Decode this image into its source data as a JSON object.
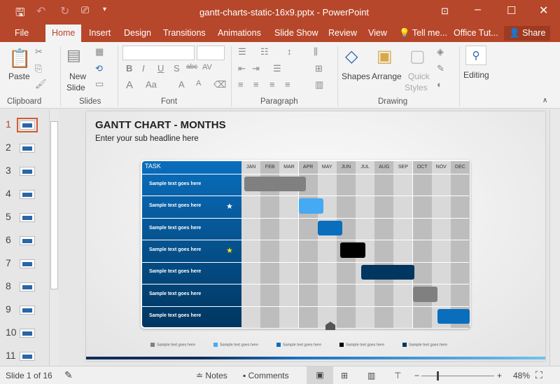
{
  "window": {
    "title": "gantt-charts-static-16x9.pptx - PowerPoint"
  },
  "tabs": [
    "File",
    "Home",
    "Insert",
    "Design",
    "Transitions",
    "Animations",
    "Slide Show",
    "Review",
    "View",
    "Tell me...",
    "Office Tut...",
    "Share"
  ],
  "active_tab": "Home",
  "ribbon": {
    "groups": [
      "Clipboard",
      "Slides",
      "Font",
      "Paragraph",
      "Drawing"
    ],
    "paste": "Paste",
    "new_slide_1": "New",
    "new_slide_2": "Slide",
    "shapes": "Shapes",
    "arrange": "Arrange",
    "quick_styles_1": "Quick",
    "quick_styles_2": "Styles",
    "editing": "Editing"
  },
  "thumbnails": [
    "1",
    "2",
    "3",
    "4",
    "5",
    "6",
    "7",
    "8",
    "9",
    "10",
    "11"
  ],
  "slide": {
    "title": "GANTT CHART - MONTHS",
    "subtitle": "Enter your sub headline here"
  },
  "chart_data": {
    "type": "gantt",
    "header": "TASK",
    "categories": [
      "JAN",
      "FEB",
      "MAR",
      "APR",
      "MAY",
      "JUN",
      "JUL",
      "AUG",
      "SEP",
      "OCT",
      "NOV",
      "DEC"
    ],
    "tasks": [
      {
        "label": "Sample text goes here",
        "start": 0.15,
        "end": 3.4,
        "color": "#808080",
        "star": null
      },
      {
        "label": "Sample text goes here",
        "start": 3.0,
        "end": 4.3,
        "color": "#45aaf2",
        "star": "#ffffff"
      },
      {
        "label": "Sample text goes here",
        "start": 4.0,
        "end": 5.3,
        "color": "#0a6ebd",
        "star": null
      },
      {
        "label": "Sample text goes here",
        "start": 5.2,
        "end": 6.5,
        "color": "#000000",
        "star": "#f2e600"
      },
      {
        "label": "Sample text goes here",
        "start": 6.3,
        "end": 9.1,
        "color": "#003660",
        "star": null
      },
      {
        "label": "Sample text goes here",
        "start": 9.0,
        "end": 10.3,
        "color": "#808080",
        "star": null
      },
      {
        "label": "Sample text goes here",
        "start": 10.3,
        "end": 12.0,
        "color": "#0a6ebd",
        "star": null
      }
    ],
    "legend": [
      {
        "label": "Sample text goes here",
        "color": "#808080"
      },
      {
        "label": "Sample text goes here",
        "color": "#45aaf2"
      },
      {
        "label": "Sample text goes here",
        "color": "#0a6ebd"
      },
      {
        "label": "Sample text goes here",
        "color": "#000000"
      },
      {
        "label": "Sample text goes here",
        "color": "#003660"
      }
    ]
  },
  "status": {
    "slide": "Slide 1 of 16",
    "notes": "Notes",
    "comments": "Comments",
    "zoom": "48%",
    "zoom_percent": 48
  },
  "colors": {
    "accent": "#b7472a"
  }
}
